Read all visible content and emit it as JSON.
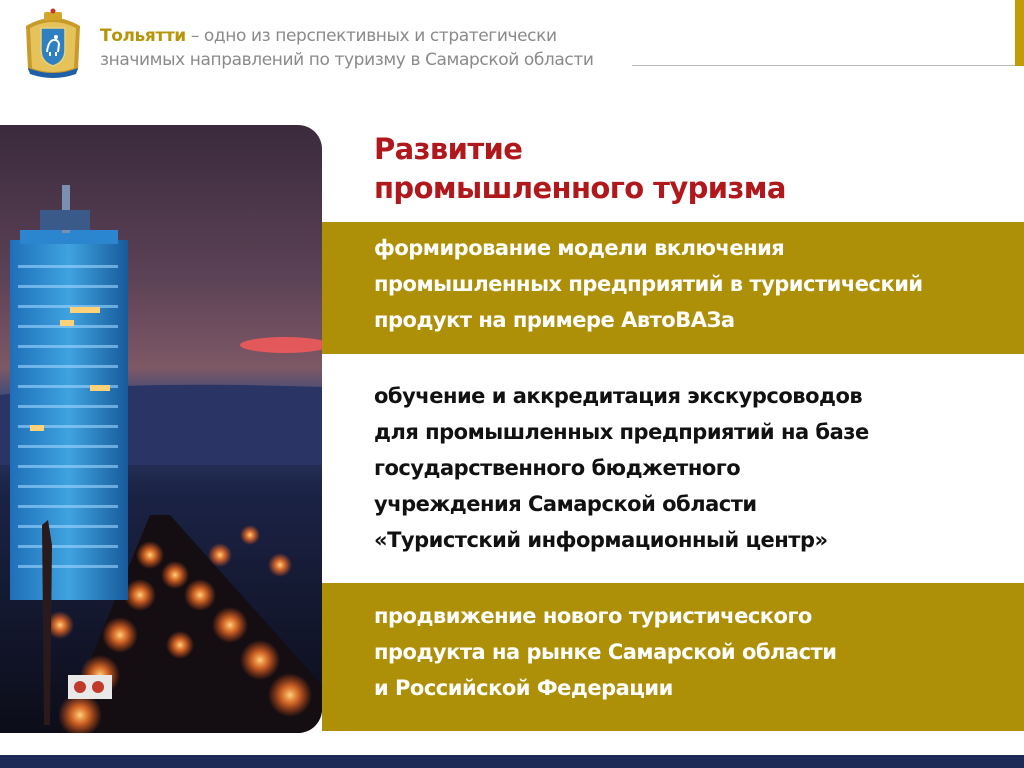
{
  "header": {
    "city": "Тольятти",
    "line1_rest": " – одно из перспективных и стратегически",
    "line2": "значимых направлений по туризму в Самарской области"
  },
  "title": {
    "line1": "Развитие",
    "line2": "промышленного туризма"
  },
  "blocks": [
    {
      "lines": [
        "формирование модели включения",
        "промышленных предприятий в туристический",
        "продукт на примере АвтоВАЗа"
      ]
    },
    {
      "lines": [
        "обучение и аккредитация экскурсоводов",
        "для промышленных предприятий на базе",
        "государственного бюджетного",
        "учреждения Самарской области",
        "«Туристский информационный центр»"
      ]
    },
    {
      "lines": [
        "продвижение нового туристического",
        "продукта на рынке Самарской области",
        "и Российской Федерации"
      ]
    }
  ],
  "colors": {
    "accent_gold": "#ae9008",
    "title_red": "#b1181c",
    "footer_navy": "#1d2a55"
  },
  "icons": {
    "emblem": "samara-region-coat-of-arms-icon"
  }
}
